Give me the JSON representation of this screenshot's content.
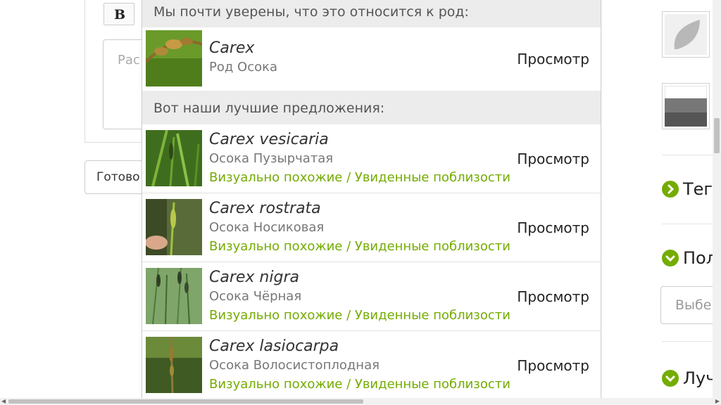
{
  "editor": {
    "bold_label": "B",
    "description_placeholder": "Рас",
    "done_label": "Готово"
  },
  "dropdown": {
    "genus_header": "Мы почти уверены, что это относится к род:",
    "genus": {
      "scientific": "Carex",
      "common": "Род Осока",
      "view": "Просмотр"
    },
    "suggestions_header": "Вот наши лучшие предложения:",
    "suggestions": [
      {
        "scientific": "Carex vesicaria",
        "common": "Осока Пузырчатая",
        "reason": "Визуально похожие / Увиденные поблизости",
        "view": "Просмотр"
      },
      {
        "scientific": "Carex rostrata",
        "common": "Осока Носиковая",
        "reason": "Визуально похожие / Увиденные поблизости",
        "view": "Просмотр"
      },
      {
        "scientific": "Carex nigra",
        "common": "Осока Чёрная",
        "reason": "Визуально похожие / Увиденные поблизости",
        "view": "Просмотр"
      },
      {
        "scientific": "Carex lasiocarpa",
        "common": "Осока Волосистоплодная",
        "reason": "Визуально похожие / Увиденные поблизости",
        "view": "Просмотр"
      }
    ]
  },
  "right_panel": {
    "items": [
      {
        "label": "Тег"
      },
      {
        "label": "Пол"
      },
      {
        "label": "Луч"
      }
    ],
    "select_placeholder": "Выбе"
  },
  "colors": {
    "accent_green": "#74ac00",
    "header_gray": "#ececec"
  }
}
